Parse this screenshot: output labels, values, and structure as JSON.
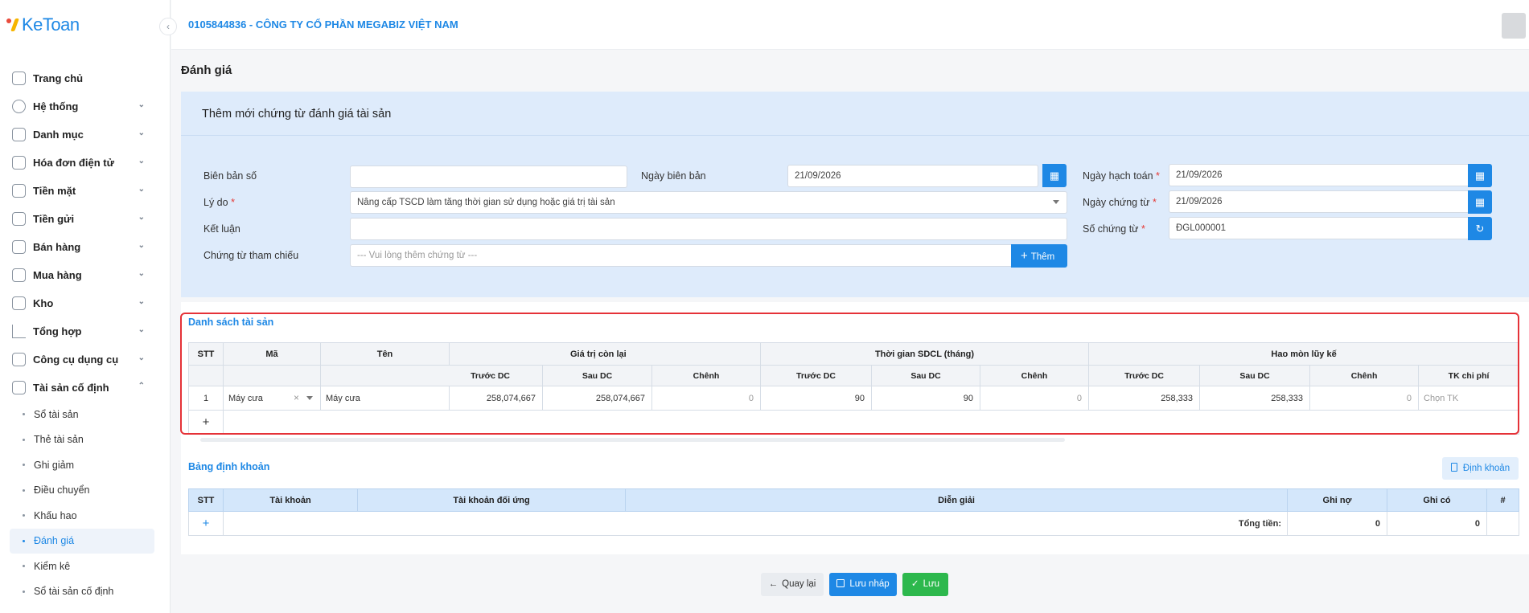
{
  "app": {
    "logo_text": "KeToan",
    "company": "0105844836 - CÔNG TY CỔ PHẦN MEGABIZ VIỆT NAM"
  },
  "sidebar": {
    "items": [
      {
        "label": "Trang chủ",
        "icon": "home-icon"
      },
      {
        "label": "Hệ thống",
        "icon": "gear-icon"
      },
      {
        "label": "Danh mục",
        "icon": "grid-icon"
      },
      {
        "label": "Hóa đơn điện tử",
        "icon": "invoice-icon"
      },
      {
        "label": "Tiền mặt",
        "icon": "cash-icon"
      },
      {
        "label": "Tiền gửi",
        "icon": "card-icon"
      },
      {
        "label": "Bán hàng",
        "icon": "bag-icon"
      },
      {
        "label": "Mua hàng",
        "icon": "cart-icon"
      },
      {
        "label": "Kho",
        "icon": "warehouse-icon"
      },
      {
        "label": "Tổng hợp",
        "icon": "chart-icon"
      },
      {
        "label": "Công cụ dụng cụ",
        "icon": "tool-icon"
      },
      {
        "label": "Tài sản cố định",
        "icon": "car-icon"
      }
    ],
    "sub_items": [
      "Sổ tài sản",
      "Thẻ tài sản",
      "Ghi giảm",
      "Điều chuyển",
      "Khấu hao",
      "Đánh giá",
      "Kiểm kê",
      "Sổ tài sản cố định"
    ]
  },
  "page": {
    "title": "Đánh giá"
  },
  "form": {
    "title": "Thêm mới chứng từ đánh giá tài sản",
    "bien_ban_so_label": "Biên bản số",
    "bien_ban_so_value": "",
    "ngay_bien_ban_label": "Ngày biên bản",
    "ngay_bien_ban_value": "21/09/2026",
    "ly_do_label": "Lý do",
    "ly_do_value": "Nâng cấp TSCD làm tăng thời gian sử dụng hoặc giá trị tài sản",
    "ket_luan_label": "Kết luận",
    "ket_luan_value": "",
    "chung_tu_tham_chieu_label": "Chứng từ tham chiếu",
    "chung_tu_tham_chieu_placeholder": "--- Vui lòng thêm chứng từ ---",
    "add_button": "Thêm",
    "ngay_hach_toan_label": "Ngày hạch toán",
    "ngay_hach_toan_value": "21/09/2026",
    "ngay_chung_tu_label": "Ngày chứng từ",
    "ngay_chung_tu_value": "21/09/2026",
    "so_chung_tu_label": "Số chứng từ",
    "so_chung_tu_value": "ĐGL000001",
    "required_mark": "*"
  },
  "asset_list": {
    "title": "Danh sách tài sản",
    "headers": {
      "stt": "STT",
      "ma": "Mã",
      "ten": "Tên",
      "gia_tri": "Giá trị còn lại",
      "thoi_gian": "Thời gian SDCL (tháng)",
      "hao_mon": "Hao mòn lũy kế"
    },
    "sub_headers": {
      "truoc": "Trước DC",
      "sau": "Sau DC",
      "chenh": "Chênh",
      "tk": "TK chi phí"
    },
    "rows": [
      {
        "stt": "1",
        "ma": "Máy cưa",
        "ten": "Máy cưa",
        "gt_truoc": "258,074,667",
        "gt_sau": "258,074,667",
        "gt_chenh": "0",
        "tg_truoc": "90",
        "tg_sau": "90",
        "tg_chenh": "0",
        "hm_truoc": "258,333",
        "hm_sau": "258,333",
        "hm_chenh": "0",
        "tk_placeholder": "Chọn TK"
      }
    ],
    "add_symbol": "+"
  },
  "ledger": {
    "title": "Bảng định khoản",
    "button": "Định khoản",
    "headers": {
      "stt": "STT",
      "tai_khoan": "Tài khoản",
      "tk_doi_ung": "Tài khoản đối ứng",
      "dien_giai": "Diễn giải",
      "ghi_no": "Ghi nợ",
      "ghi_co": "Ghi có",
      "hash": "#"
    },
    "total_label": "Tổng tiền:",
    "total_no": "0",
    "total_co": "0",
    "add_symbol": "+"
  },
  "footer": {
    "back": "Quay lại",
    "draft": "Lưu nháp",
    "save": "Lưu"
  },
  "colors": {
    "primary": "#1e88e5",
    "success": "#2db84d",
    "highlight": "#e53238",
    "panel": "#deebfb"
  }
}
